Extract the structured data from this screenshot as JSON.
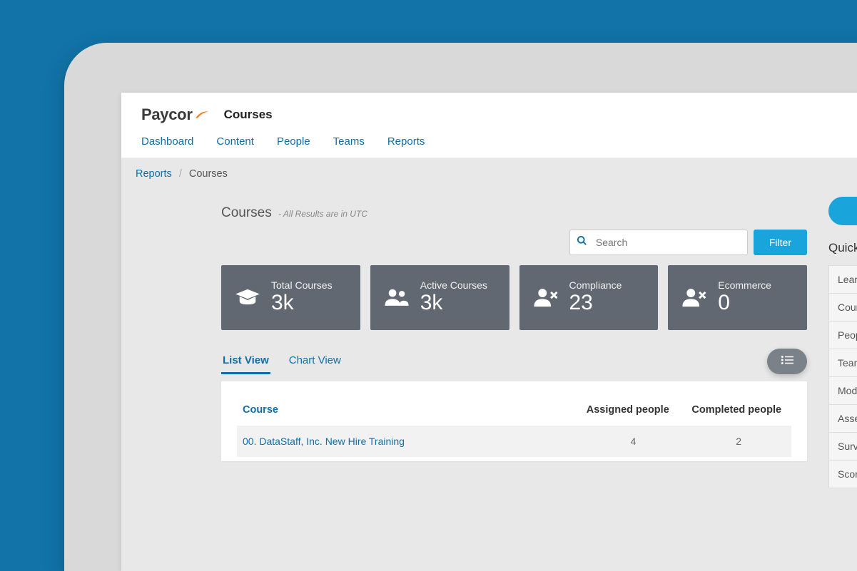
{
  "brand": {
    "name": "Paycor",
    "app": "Courses"
  },
  "nav": {
    "items": [
      "Dashboard",
      "Content",
      "People",
      "Teams",
      "Reports"
    ]
  },
  "breadcrumb": {
    "parent": "Reports",
    "current": "Courses"
  },
  "page": {
    "title": "Courses",
    "subtitle": "- All Results are in UTC"
  },
  "search": {
    "placeholder": "Search"
  },
  "filter_label": "Filter",
  "cards": [
    {
      "label": "Total Courses",
      "value": "3k",
      "icon": "graduation-cap-icon"
    },
    {
      "label": "Active Courses",
      "value": "3k",
      "icon": "users-group-icon"
    },
    {
      "label": "Compliance",
      "value": "23",
      "icon": "user-x-icon"
    },
    {
      "label": "Ecommerce",
      "value": "0",
      "icon": "user-x-icon"
    }
  ],
  "tabs": {
    "list": "List View",
    "chart": "Chart View",
    "active": "list"
  },
  "table": {
    "columns": [
      "Course",
      "Assigned people",
      "Completed people"
    ],
    "rows": [
      {
        "course": "00. DataStaff, Inc. New Hire Training",
        "assigned": "4",
        "completed": "2"
      }
    ]
  },
  "side": {
    "title": "Quick rep",
    "items": [
      "Learnin",
      "Course",
      "People",
      "Teams",
      "Module",
      "Assess",
      "Survey",
      "Scorm"
    ]
  }
}
